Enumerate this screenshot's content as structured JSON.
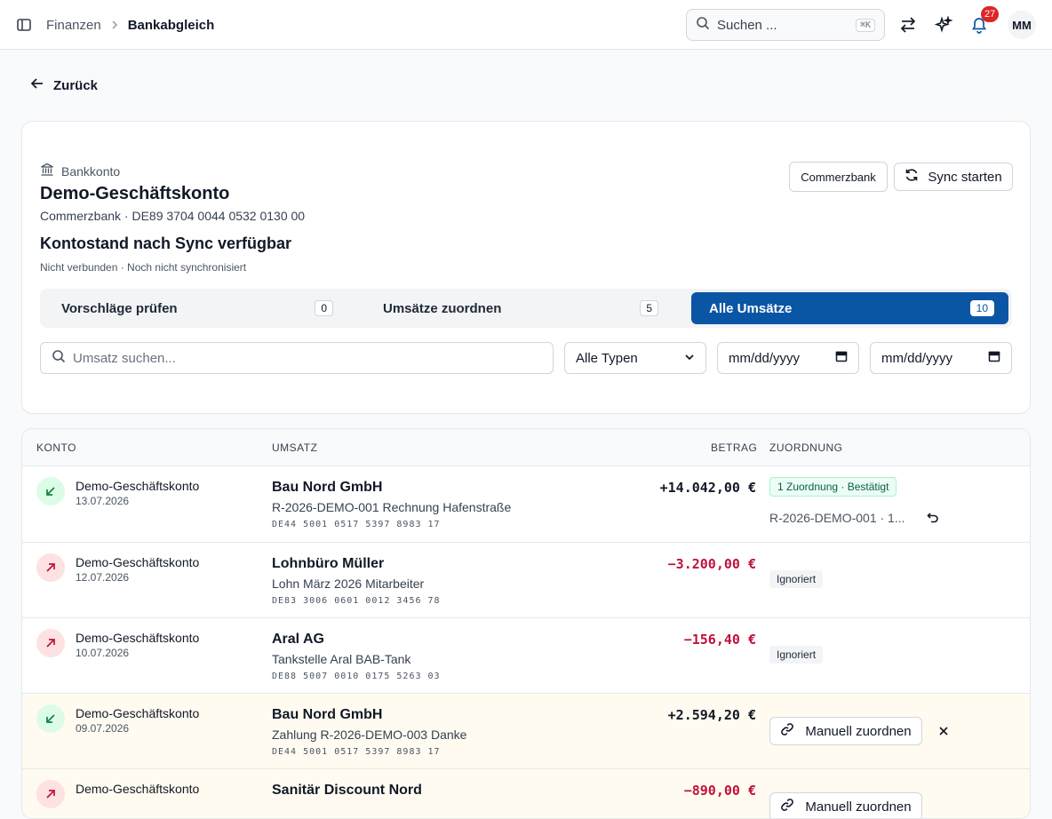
{
  "header": {
    "breadcrumb": [
      "Finanzen",
      "Bankabgleich"
    ],
    "search_placeholder": "Suchen ...",
    "search_shortcut": "⌘K",
    "notification_count": "27",
    "avatar_initials": "MM"
  },
  "back_label": "Zurück",
  "account": {
    "type_label": "Bankkonto",
    "name": "Demo-Geschäftskonto",
    "bank_iban": "Commerzbank · DE89 3704 0044 0532 0130 00",
    "balance_text": "Kontostand nach Sync verfügbar",
    "status_text": "Nicht verbunden · Noch nicht synchronisiert",
    "bank_button": "Commerzbank",
    "sync_button": "Sync starten"
  },
  "tabs": [
    {
      "label": "Vorschläge prüfen",
      "count": "0",
      "active": false
    },
    {
      "label": "Umsätze zuordnen",
      "count": "5",
      "active": false
    },
    {
      "label": "Alle Umsätze",
      "count": "10",
      "active": true
    }
  ],
  "filters": {
    "search_placeholder": "Umsatz suchen...",
    "type_value": "Alle Typen",
    "date_from_placeholder": "mm/dd/yyyy",
    "date_to_placeholder": "mm/dd/yyyy"
  },
  "table": {
    "columns": [
      "KONTO",
      "UMSATZ",
      "BETRAG",
      "ZUORDNUNG"
    ],
    "rows": [
      {
        "direction": "in",
        "account": "Demo-Geschäftskonto",
        "date": "13.07.2026",
        "counterparty": "Bau Nord GmbH",
        "purpose": "R-2026-DEMO-001 Rechnung Hafenstraße",
        "iban": "DE44 5001 0517 5397 8983 17",
        "amount": "+14.042,00 €",
        "status": "1 Zuordnung · Bestätigt",
        "ref": "R-2026-DEMO-001 · 1..."
      },
      {
        "direction": "out",
        "account": "Demo-Geschäftskonto",
        "date": "12.07.2026",
        "counterparty": "Lohnbüro Müller",
        "purpose": "Lohn März 2026 Mitarbeiter",
        "iban": "DE83 3006 0601 0012 3456 78",
        "amount": "−3.200,00 €",
        "status": "Ignoriert"
      },
      {
        "direction": "out",
        "account": "Demo-Geschäftskonto",
        "date": "10.07.2026",
        "counterparty": "Aral AG",
        "purpose": "Tankstelle Aral BAB-Tank",
        "iban": "DE88 5007 0010 0175 5263 03",
        "amount": "−156,40 €",
        "status": "Ignoriert"
      },
      {
        "direction": "in",
        "account": "Demo-Geschäftskonto",
        "date": "09.07.2026",
        "counterparty": "Bau Nord GmbH",
        "purpose": "Zahlung R-2026-DEMO-003 Danke",
        "iban": "DE44 5001 0517 5397 8983 17",
        "amount": "+2.594,20 €",
        "action": "Manuell zuordnen"
      },
      {
        "direction": "out",
        "account": "Demo-Geschäftskonto",
        "date": "",
        "counterparty": "Sanitär Discount Nord",
        "purpose": "",
        "iban": "",
        "amount": "−890,00 €",
        "action": "Manuell zuordnen"
      }
    ]
  },
  "colors": {
    "primary": "#0a56a5",
    "negative": "#be123c",
    "badge": "#dc2626"
  }
}
